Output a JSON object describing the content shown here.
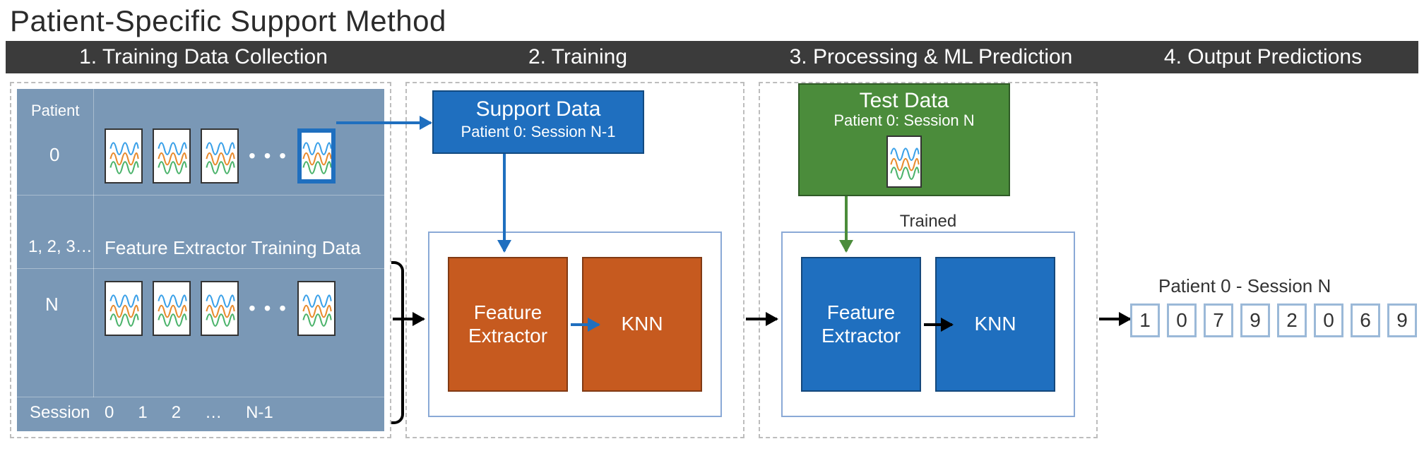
{
  "title": "Patient-Specific Support Method",
  "phases": {
    "p1": "1. Training Data Collection",
    "p2": "2. Training",
    "p3": "3. Processing & ML Prediction",
    "p4": "4. Output Predictions"
  },
  "grid": {
    "patient_label": "Patient",
    "row0": "0",
    "row_mid": "1, 2, 3…",
    "rowN": "N",
    "session_label": "Session",
    "sessions": [
      "0",
      "1",
      "2",
      "…",
      "N-1"
    ],
    "fe_train_label": "Feature Extractor Training Data"
  },
  "support": {
    "title": "Support Data",
    "subtitle": "Patient 0:  Session N-1"
  },
  "test": {
    "title": "Test Data",
    "subtitle": "Patient 0:  Session N"
  },
  "blocks": {
    "feature_extractor": "Feature\nExtractor",
    "knn": "KNN",
    "trained_label": "Trained"
  },
  "output": {
    "label": "Patient 0 - Session N",
    "values": [
      "1",
      "0",
      "7",
      "9",
      "2",
      "0",
      "6",
      "9"
    ]
  }
}
